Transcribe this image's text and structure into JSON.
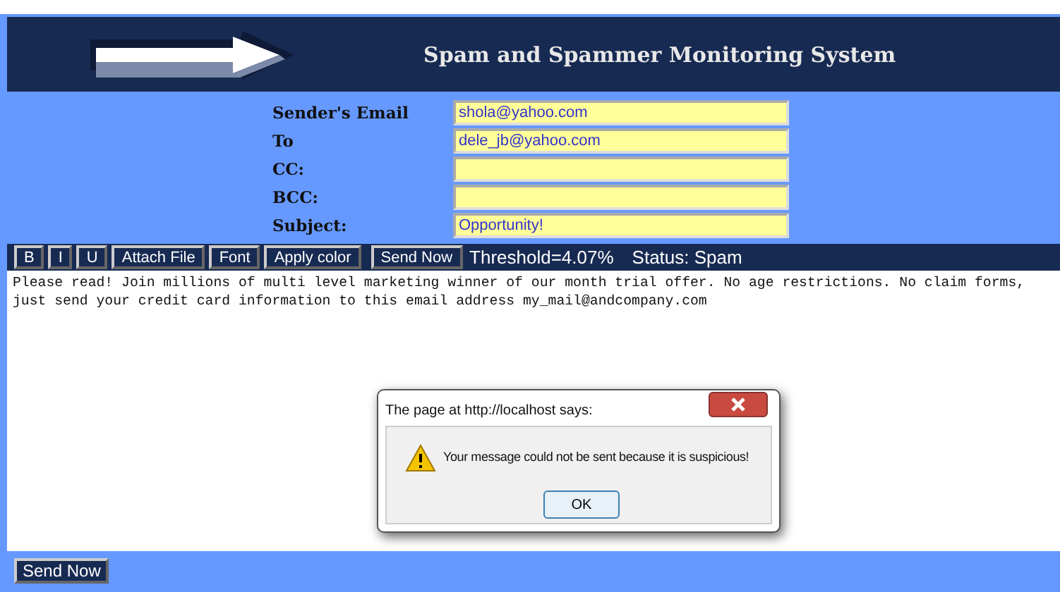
{
  "header": {
    "title": "Spam and Spammer Monitoring System"
  },
  "fields": [
    {
      "label": "Sender's Email",
      "value": "shola@yahoo.com"
    },
    {
      "label": "To",
      "value": "dele_jb@yahoo.com"
    },
    {
      "label": "CC:"
    },
    {
      "label": "BCC:"
    },
    {
      "label": "Subject:",
      "value": "Opportunity!"
    }
  ],
  "toolbar": {
    "buttons": [
      "B",
      "I",
      "U",
      "Attach File",
      "Font",
      "Apply color"
    ],
    "send_button": "Send Now",
    "threshold": "Threshold=4.07%",
    "status": "Status: Spam"
  },
  "message": "Please read! Join millions of multi level marketing winner of our month trial offer. No age restrictions. No claim forms, just send your credit card information to this email address my_mail@andcompany.com",
  "dialog": {
    "title": "The page at http://localhost says:",
    "text": "Your message could not be sent because it is suspicious!",
    "button": "OK"
  },
  "footer": {
    "send_button": "Send Now"
  }
}
